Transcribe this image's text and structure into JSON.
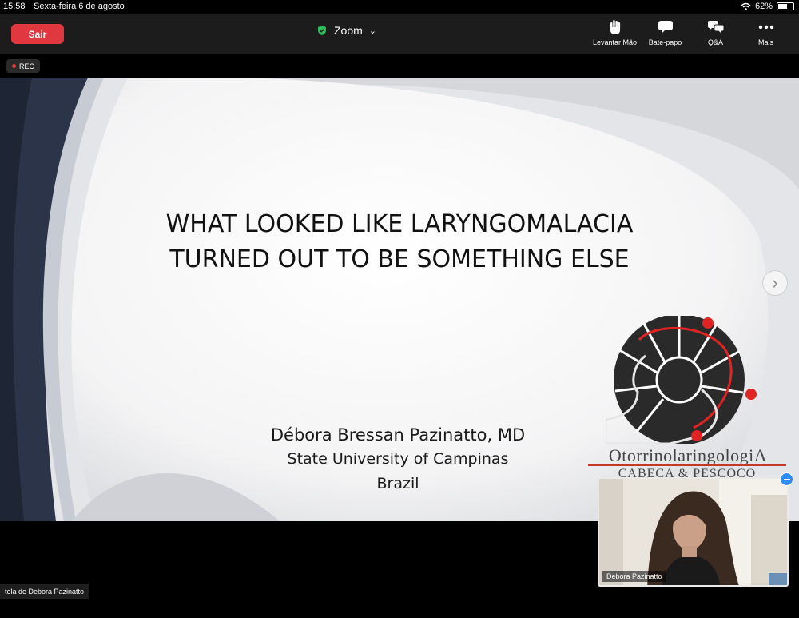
{
  "status_bar": {
    "time": "15:58",
    "date": "Sexta-feira 6 de agosto",
    "battery_percent": "62%",
    "battery_level": 0.62
  },
  "header": {
    "leave_label": "Sair",
    "app_title": "Zoom",
    "actions": [
      {
        "label": "Levantar Mão",
        "icon": "raise-hand-icon"
      },
      {
        "label": "Bate-papo",
        "icon": "chat-icon"
      },
      {
        "label": "Q&A",
        "icon": "qa-icon"
      },
      {
        "label": "Mais",
        "icon": "more-icon"
      }
    ]
  },
  "recording": {
    "label": "REC"
  },
  "slide": {
    "title_line1": "WHAT LOOKED LIKE LARYNGOMALACIA",
    "title_line2": "TURNED OUT TO BE SOMETHING ELSE",
    "author": "Débora Bressan Pazinatto, MD",
    "institution": "State University of Campinas",
    "country": "Brazil",
    "logo_line1": "OtorrinolaringologiA",
    "logo_line2": "CABEÇA & PESCOÇO"
  },
  "share_label": "tela de Debora Pazinatto",
  "video": {
    "participant_name": "Debora Pazinatto"
  },
  "colors": {
    "leave_button": "#e0383e",
    "zoom_shield": "#2dbd5a",
    "logo_red": "#e02424",
    "slide_dark_band": "#2b3448"
  }
}
